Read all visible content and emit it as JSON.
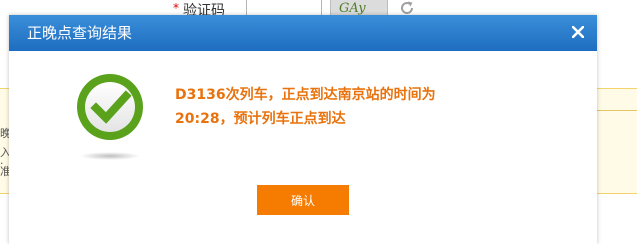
{
  "background": {
    "required_mark": "*",
    "captcha_label": "验证码",
    "captcha_image_text": "GAy",
    "side_text": [
      "晚",
      "入",
      "·",
      "准"
    ]
  },
  "dialog": {
    "title": "正晚点查询结果",
    "close_symbol": "×",
    "message_line1": "D3136次列车，正点到达南京站的时间为",
    "message_line2": "20:28，预计列车正点到达",
    "confirm_label": "确认"
  },
  "colors": {
    "header_blue": "#2b7dcc",
    "message_orange": "#e8730e",
    "button_orange": "#f57c00",
    "success_green": "#5aa21c"
  },
  "icons": {
    "success": "check-circle-icon",
    "close": "close-icon",
    "refresh": "refresh-icon"
  }
}
